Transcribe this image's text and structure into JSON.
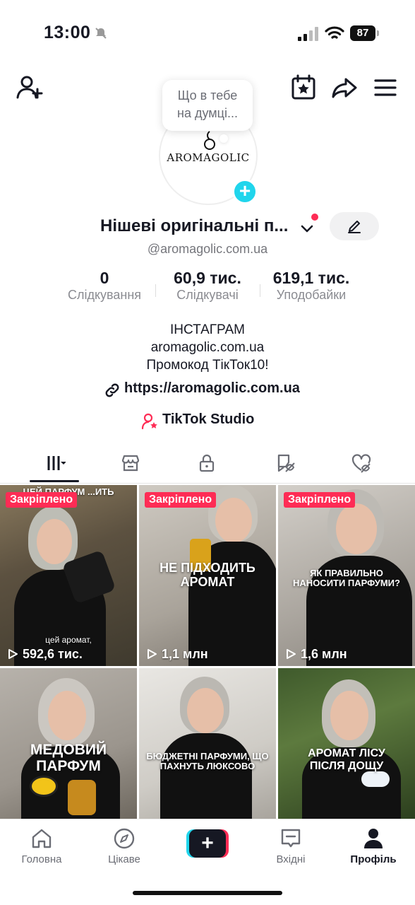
{
  "status_bar": {
    "time": "13:00",
    "battery": "87"
  },
  "avatar": {
    "brand_text": "AROMAGOLIC"
  },
  "note_bubble": {
    "line1": "Що в тебе",
    "line2": "на думці..."
  },
  "profile": {
    "name": "Нішеві оригінальні п...",
    "username": "@aromagolic.com.ua"
  },
  "stats": [
    {
      "value": "0",
      "label": "Слідкування"
    },
    {
      "value": "60,9 тис.",
      "label": "Слідкувачі"
    },
    {
      "value": "619,1 тис.",
      "label": "Уподобайки"
    }
  ],
  "bio": {
    "line1": "ІНСТАГРАМ",
    "line2": "aromagolic.com.ua",
    "line3": "Промокод ТікТок10!",
    "link": "https://aromagolic.com.ua",
    "studio": "TikTok Studio"
  },
  "videos": [
    {
      "pinned": "Закріплено",
      "top_caption": "ЦЕЙ ПАРФУМ ...ИТЬ",
      "caption": "",
      "bottom_caption": "цей аромат,",
      "views": "592,6 тис."
    },
    {
      "pinned": "Закріплено",
      "caption": "НЕ ПІДХОДИТЬ АРОМАТ",
      "views": "1,1 млн"
    },
    {
      "pinned": "Закріплено",
      "caption": "ЯК ПРАВИЛЬНО НАНОСИТИ ПАРФУМИ?",
      "views": "1,6 млн"
    },
    {
      "caption": "МЕДОВИЙ ПАРФУМ"
    },
    {
      "caption": "БЮДЖЕТНІ ПАРФУМИ, ЩО ПАХНУТЬ ЛЮКСОВО"
    },
    {
      "caption": "АРОМАТ ЛІСУ ПІСЛЯ ДОЩУ"
    }
  ],
  "nav": {
    "home": "Головна",
    "discover": "Цікаве",
    "create": "+",
    "inbox": "Вхідні",
    "profile": "Профіль"
  },
  "colors": {
    "accent_red": "#fe2c55",
    "accent_cyan": "#20d5ec",
    "text": "#161823"
  },
  "icons": [
    "add-friend-icon",
    "calendar-star-icon",
    "share-icon",
    "menu-icon",
    "link-icon",
    "studio-icon",
    "grid-icon",
    "shop-icon",
    "lock-icon",
    "repost-icon",
    "liked-icon",
    "home-icon",
    "compass-icon",
    "inbox-icon",
    "profile-icon"
  ]
}
